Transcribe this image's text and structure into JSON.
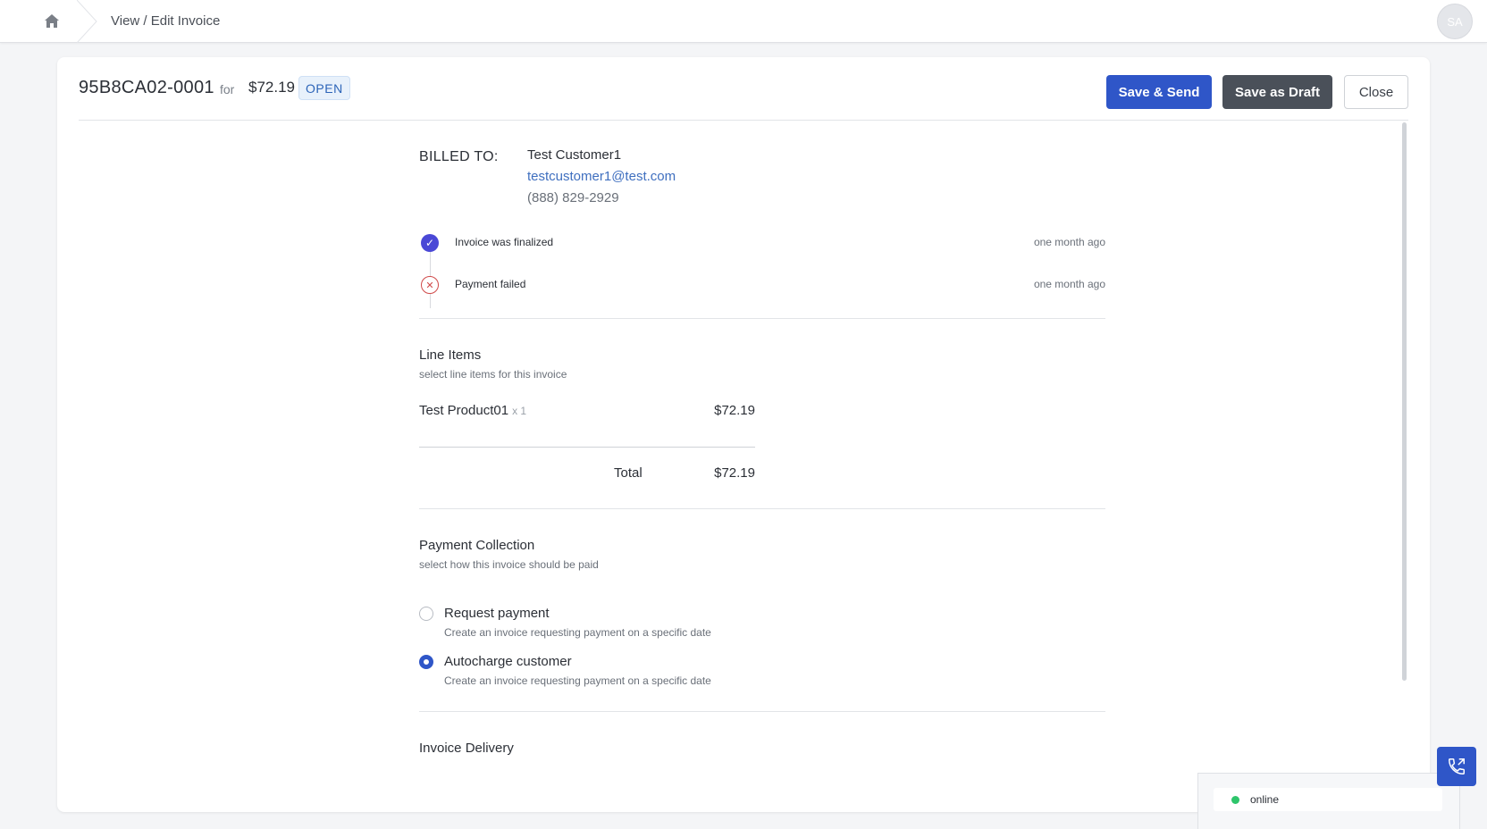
{
  "header": {
    "breadcrumb": "View / Edit Invoice",
    "avatar_initials": "SA"
  },
  "invoice": {
    "number": "95B8CA02-0001",
    "for_label": "for",
    "amount": "$72.19",
    "status": "OPEN"
  },
  "actions": {
    "save_send": "Save & Send",
    "save_draft": "Save as Draft",
    "close": "Close"
  },
  "billing": {
    "label": "BILLED TO:",
    "name": "Test Customer1",
    "email": "testcustomer1@test.com",
    "phone": "(888) 829-2929"
  },
  "timeline": [
    {
      "text": "Invoice was finalized",
      "time": "one month ago",
      "status": "success"
    },
    {
      "text": "Payment failed",
      "time": "one month ago",
      "status": "failed"
    }
  ],
  "line_items": {
    "title": "Line Items",
    "subtitle": "select line items for this invoice",
    "items": [
      {
        "name": "Test Product01",
        "qty": "x 1",
        "price": "$72.19"
      }
    ],
    "total_label": "Total",
    "total_value": "$72.19"
  },
  "payment_collection": {
    "title": "Payment Collection",
    "subtitle": "select how this invoice should be paid",
    "options": [
      {
        "label": "Request payment",
        "description": "Create an invoice requesting payment on a specific date",
        "selected": false
      },
      {
        "label": "Autocharge customer",
        "description": "Create an invoice requesting payment on a specific date",
        "selected": true
      }
    ]
  },
  "invoice_delivery": {
    "title": "Invoice Delivery"
  },
  "phone_widget": {
    "status": "online",
    "status_color": "#2ec56b"
  },
  "colors": {
    "primary": "#2f56c8",
    "dark_button": "#4a5059",
    "link": "#3f6fbf",
    "badge_bg": "#e8f1fb",
    "error": "#d04a4a",
    "timeline_ok": "#4a48d6"
  }
}
